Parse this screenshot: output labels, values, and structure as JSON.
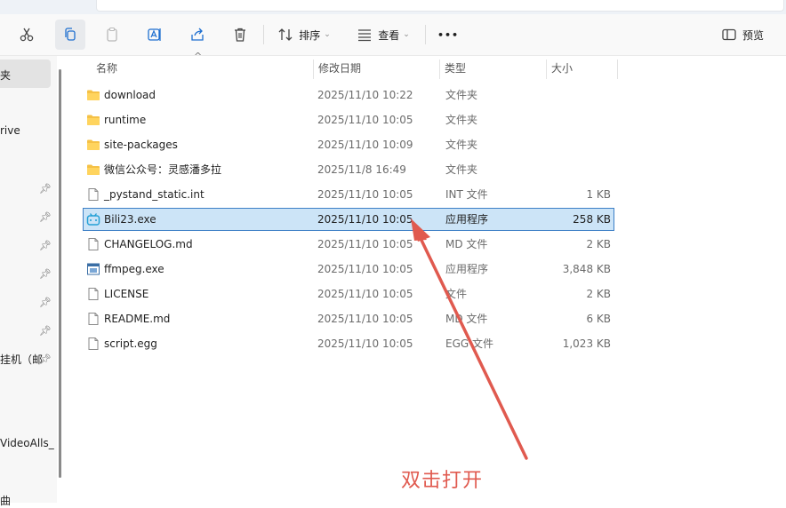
{
  "toolbar": {
    "sort_label": "排序",
    "view_label": "查看",
    "more_label": "•••",
    "preview_label": "预览"
  },
  "sidebar": {
    "items": [
      "夹",
      "rive",
      "挂机（邮",
      "VideoAlls_",
      "曲"
    ]
  },
  "header": {
    "name": "名称",
    "modified": "修改日期",
    "type": "类型",
    "size": "大小"
  },
  "files": [
    {
      "name": "download",
      "modified": "2025/11/10 10:22",
      "type": "文件夹",
      "size": "",
      "icon": "folder-icon"
    },
    {
      "name": "runtime",
      "modified": "2025/11/10 10:05",
      "type": "文件夹",
      "size": "",
      "icon": "folder-icon"
    },
    {
      "name": "site-packages",
      "modified": "2025/11/10 10:09",
      "type": "文件夹",
      "size": "",
      "icon": "folder-icon"
    },
    {
      "name": "微信公众号：灵感潘多拉",
      "modified": "2025/11/8 16:49",
      "type": "文件夹",
      "size": "",
      "icon": "folder-icon"
    },
    {
      "name": "_pystand_static.int",
      "modified": "2025/11/10 10:05",
      "type": "INT 文件",
      "size": "1 KB",
      "icon": "file-icon"
    },
    {
      "name": "Bili23.exe",
      "modified": "2025/11/10 10:05",
      "type": "应用程序",
      "size": "258 KB",
      "icon": "bilibili-app-icon"
    },
    {
      "name": "CHANGELOG.md",
      "modified": "2025/11/10 10:05",
      "type": "MD 文件",
      "size": "2 KB",
      "icon": "file-icon"
    },
    {
      "name": "ffmpeg.exe",
      "modified": "2025/11/10 10:05",
      "type": "应用程序",
      "size": "3,848 KB",
      "icon": "exe-app-icon"
    },
    {
      "name": "LICENSE",
      "modified": "2025/11/10 10:05",
      "type": "文件",
      "size": "2 KB",
      "icon": "file-icon"
    },
    {
      "name": "README.md",
      "modified": "2025/11/10 10:05",
      "type": "MD 文件",
      "size": "6 KB",
      "icon": "file-icon"
    },
    {
      "name": "script.egg",
      "modified": "2025/11/10 10:05",
      "type": "EGG 文件",
      "size": "1,023 KB",
      "icon": "file-icon"
    }
  ],
  "annotation": {
    "text": "双击打开",
    "color": "#e05a4f"
  },
  "colors": {
    "selection_bg": "#cce4f7",
    "selection_border": "#3c7fc6",
    "folder": "#f5c146",
    "accent": "#1e88e5"
  }
}
